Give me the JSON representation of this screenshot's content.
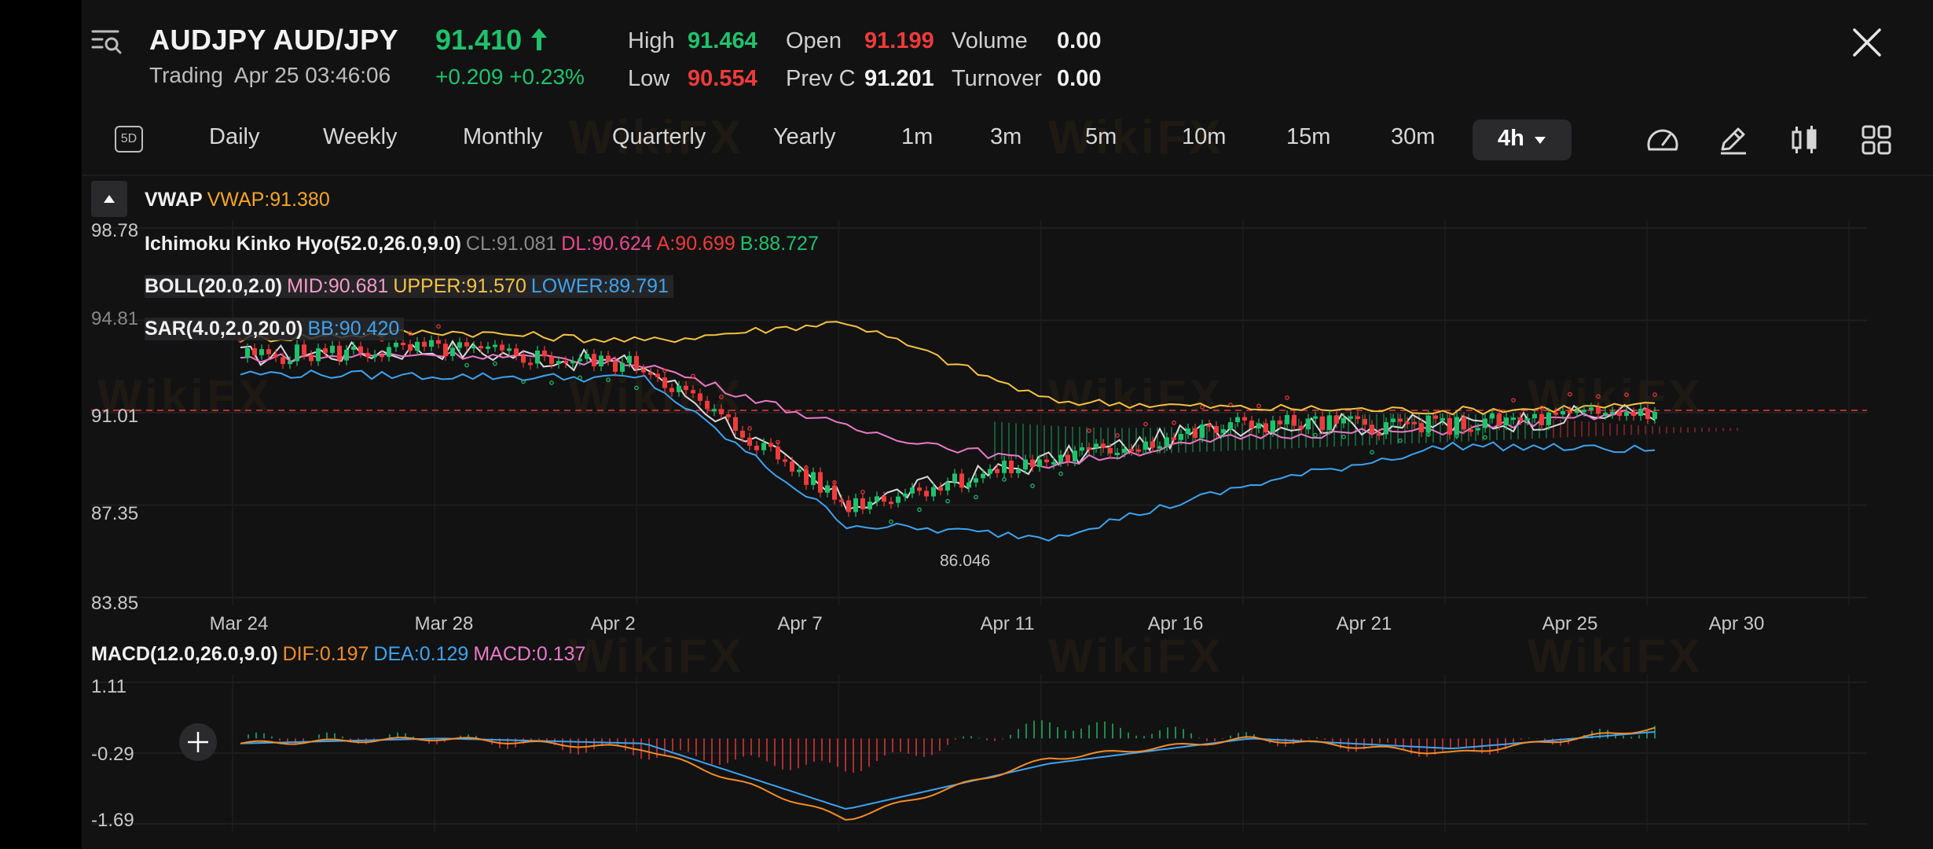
{
  "header": {
    "symbol": "AUDJPY AUD/JPY",
    "status": "Trading",
    "datetime": "Apr 25 03:46:06",
    "price": "91.410",
    "change": "+0.209",
    "change_pct": "+0.23%",
    "high_label": "High",
    "high": "91.464",
    "low_label": "Low",
    "low": "90.554",
    "open_label": "Open",
    "open": "91.199",
    "prevc_label": "Prev C",
    "prevc": "91.201",
    "volume_label": "Volume",
    "volume": "0.00",
    "turnover_label": "Turnover",
    "turnover": "0.00"
  },
  "timeframes": {
    "five_day": "5D",
    "items": [
      "Daily",
      "Weekly",
      "Monthly",
      "Quarterly",
      "Yearly",
      "1m",
      "3m",
      "5m",
      "10m",
      "15m",
      "30m"
    ],
    "active": "4h"
  },
  "tools": [
    "speedometer-icon",
    "pencil-icon",
    "candle-style-icon",
    "grid-icon"
  ],
  "indicators": {
    "vwap_name": "VWAP",
    "vwap": "VWAP:91.380",
    "ichimoku_name": "Ichimoku Kinko Hyo(52.0,26.0,9.0)",
    "ichimoku_cl": "CL:91.081",
    "ichimoku_dl": "DL:90.624",
    "ichimoku_a": "A:90.699",
    "ichimoku_b": "B:88.727",
    "boll_name": "BOLL(20.0,2.0)",
    "boll_mid": "MID:90.681",
    "boll_upper": "UPPER:91.570",
    "boll_lower": "LOWER:89.791",
    "sar_name": "SAR(4.0,2.0,20.0)",
    "sar_bb": "BB:90.420",
    "macd_name": "MACD(12.0,26.0,9.0)",
    "macd_dif": "DIF:0.197",
    "macd_dea": "DEA:0.129",
    "macd_macd": "MACD:0.137"
  },
  "chart_axes": {
    "y_main": [
      "98.78",
      "94.81",
      "91.01",
      "87.35",
      "83.85"
    ],
    "y_macd": [
      "1.11",
      "-0.29",
      "-1.69"
    ],
    "x": [
      "Mar 24",
      "Mar 28",
      "Apr 2",
      "Apr 7",
      "Apr 11",
      "Apr 16",
      "Apr 21",
      "Apr 25",
      "Apr 30"
    ],
    "low_marker": "86.046"
  },
  "watermark": "WikiFX",
  "colors": {
    "green": "#1fc26b",
    "red": "#ef3b3b",
    "yellow": "#f5c242",
    "pink": "#e879c7",
    "blue": "#3ea3ee",
    "orange": "#f28c28",
    "bg": "#121213"
  },
  "chart_data": {
    "type": "line",
    "title": "AUDJPY AUD/JPY",
    "interval": "4h",
    "ylim": [
      83.85,
      98.78
    ],
    "x": [
      "Mar 24",
      "Mar 28",
      "Apr 2",
      "Apr 7",
      "Apr 11",
      "Apr 16",
      "Apr 21",
      "Apr 25",
      "Apr 30"
    ],
    "series": [
      {
        "name": "Close",
        "values": [
          93.6,
          93.9,
          93.2,
          87.6,
          89.4,
          90.9,
          90.8,
          91.4,
          null
        ]
      },
      {
        "name": "BOLL UPPER",
        "values": [
          94.3,
          94.6,
          94.2,
          95.0,
          91.8,
          91.5,
          91.4,
          91.6,
          null
        ]
      },
      {
        "name": "BOLL LOWER",
        "values": [
          92.9,
          92.8,
          92.7,
          86.8,
          86.3,
          88.4,
          90.0,
          89.8,
          null
        ]
      },
      {
        "name": "VWAP",
        "values": [
          93.5,
          93.7,
          93.3,
          90.7,
          89.2,
          90.4,
          90.6,
          91.4,
          null
        ]
      }
    ],
    "macd": {
      "ylim": [
        -1.69,
        1.11
      ],
      "dif": [
        -0.1,
        0.0,
        -0.2,
        -1.6,
        -0.4,
        0.0,
        -0.3,
        0.2,
        null
      ],
      "dea": [
        -0.1,
        0.0,
        -0.1,
        -1.4,
        -0.5,
        0.0,
        -0.2,
        0.13,
        null
      ]
    }
  }
}
